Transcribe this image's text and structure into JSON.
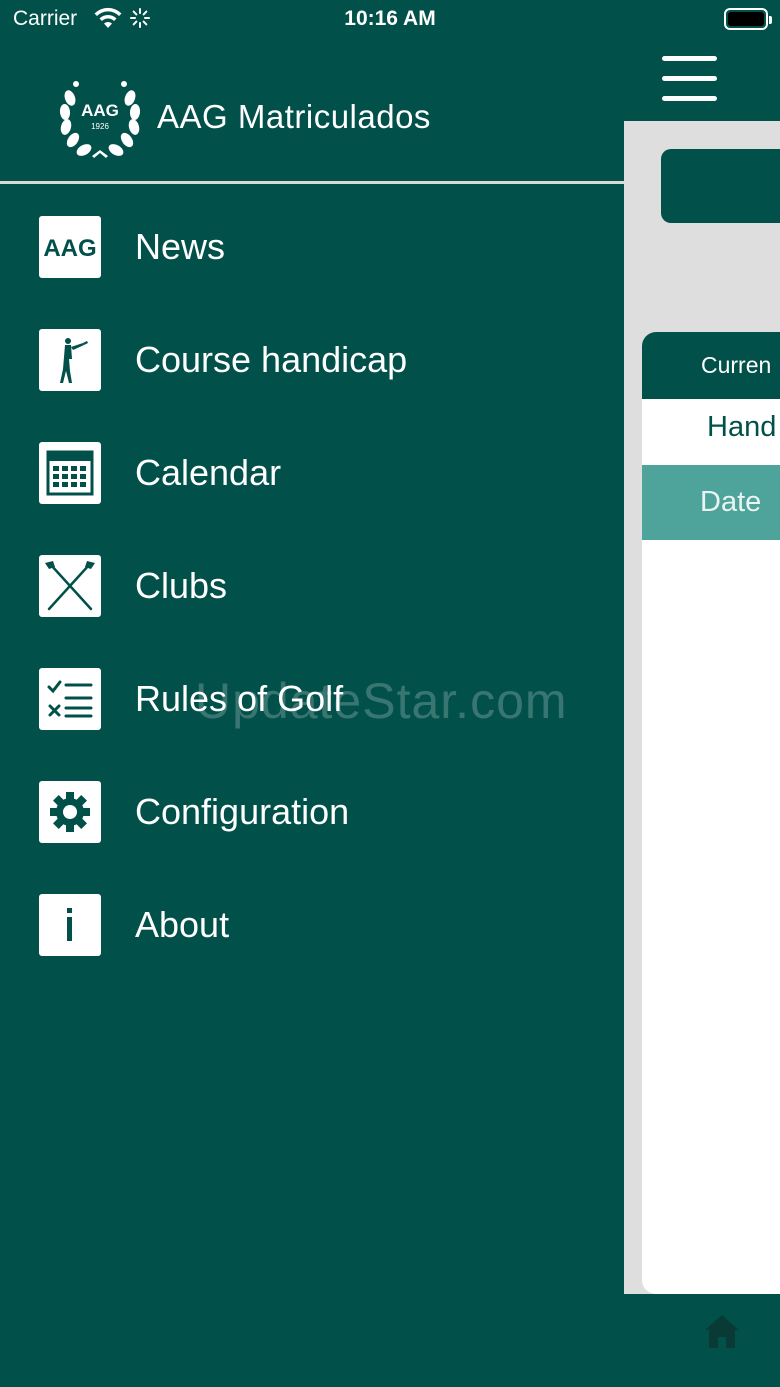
{
  "status_bar": {
    "carrier": "Carrier",
    "time": "10:16 AM"
  },
  "drawer": {
    "logo": {
      "text": "AAG",
      "year": "1926",
      "icon": "laurel-wreath-logo"
    },
    "title": "AAG Matriculados",
    "items": [
      {
        "label": "News",
        "icon": "aag-news-icon"
      },
      {
        "label": "Course handicap",
        "icon": "golfer-icon"
      },
      {
        "label": "Calendar",
        "icon": "calendar-icon"
      },
      {
        "label": "Clubs",
        "icon": "crossed-clubs-icon"
      },
      {
        "label": "Rules of Golf",
        "icon": "checklist-icon"
      },
      {
        "label": "Configuration",
        "icon": "gear-icon"
      },
      {
        "label": "About",
        "icon": "info-icon"
      }
    ]
  },
  "watermark": "UpdateStar.com",
  "content": {
    "card_header": "Curren",
    "row_label": "Hand",
    "column_header": "Date"
  },
  "colors": {
    "primary": "#02504a",
    "accent": "#4ea39a",
    "background": "#dedede",
    "divider": "#d9d9d9"
  }
}
